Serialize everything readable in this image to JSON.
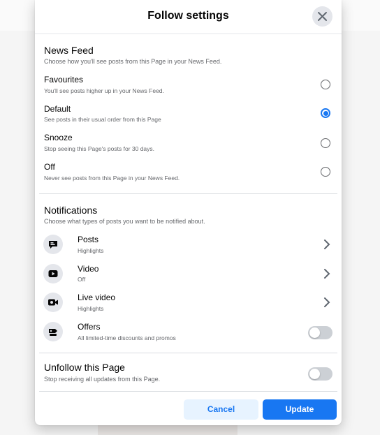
{
  "dialog": {
    "title": "Follow settings"
  },
  "news_feed": {
    "title": "News Feed",
    "description": "Choose how you'll see posts from this Page in your News Feed.",
    "options": [
      {
        "label": "Favourites",
        "sub": "You'll see posts higher up in your News Feed.",
        "selected": false
      },
      {
        "label": "Default",
        "sub": "See posts in their usual order from this Page",
        "selected": true
      },
      {
        "label": "Snooze",
        "sub": "Stop seeing this Page's posts for 30 days.",
        "selected": false
      },
      {
        "label": "Off",
        "sub": "Never see posts from this Page in your News Feed.",
        "selected": false
      }
    ]
  },
  "notifications": {
    "title": "Notifications",
    "description": "Choose what types of posts you want to be notified about.",
    "items": [
      {
        "label": "Posts",
        "sub": "Highlights",
        "icon": "post-icon",
        "control": "chevron"
      },
      {
        "label": "Video",
        "sub": "Off",
        "icon": "video-play-icon",
        "control": "chevron"
      },
      {
        "label": "Live video",
        "sub": "Highlights",
        "icon": "live-video-icon",
        "control": "chevron"
      },
      {
        "label": "Offers",
        "sub": "All limited-time discounts and promos",
        "icon": "offer-tag-icon",
        "control": "toggle",
        "on": false
      }
    ]
  },
  "unfollow": {
    "title": "Unfollow this Page",
    "description": "Stop receiving all updates from this Page.",
    "on": false
  },
  "footer": {
    "cancel_label": "Cancel",
    "update_label": "Update"
  },
  "colors": {
    "accent": "#1877f2",
    "secondary_text": "#65676b",
    "cancel_bg": "#e7f3ff"
  }
}
